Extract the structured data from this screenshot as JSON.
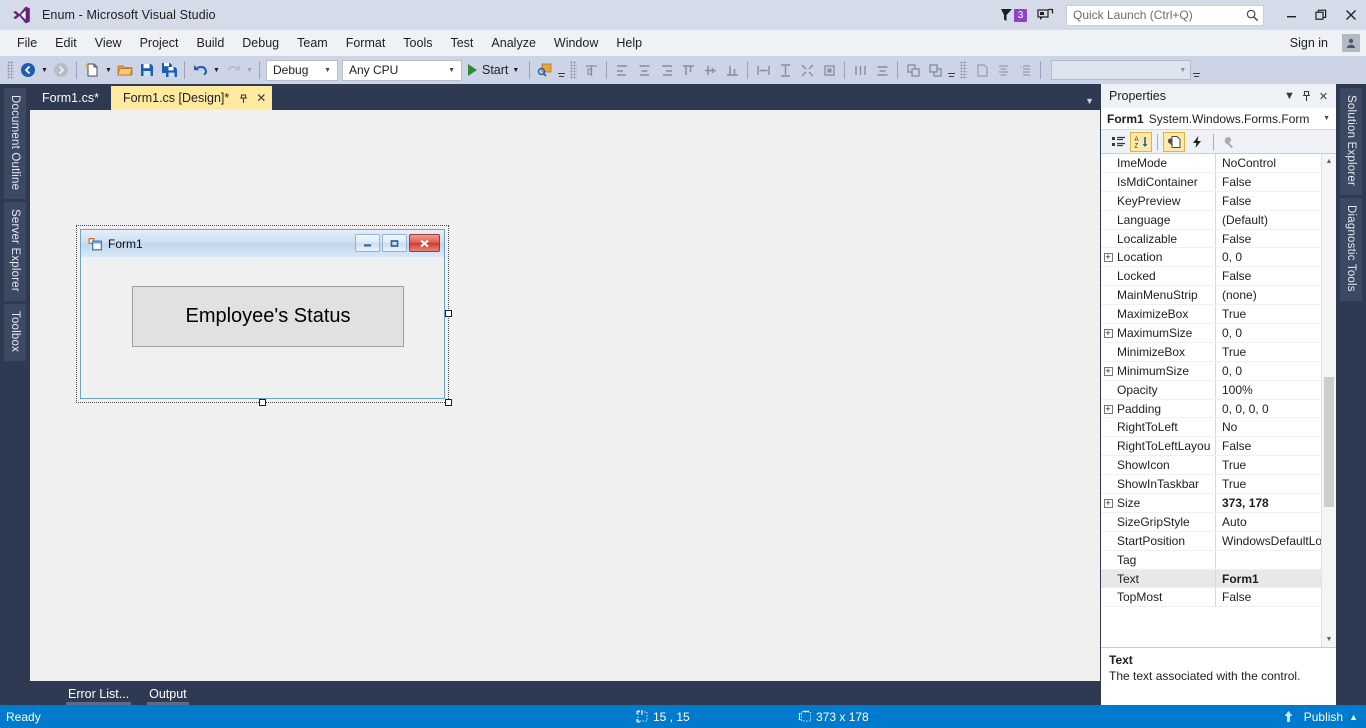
{
  "titlebar": {
    "app_title": "Enum - Microsoft Visual Studio",
    "logo_icon": "visual-studio-logo",
    "notification_icon": "notification-flag-icon",
    "notification_count": "3",
    "feedback_icon": "feedback-icon",
    "minimize_label": "–",
    "maximize_label": "❐",
    "close_label": "✕"
  },
  "quick_launch": {
    "placeholder": "Quick Launch (Ctrl+Q)",
    "value": "",
    "search_icon": "search-icon"
  },
  "menubar": {
    "items": [
      {
        "label": "File"
      },
      {
        "label": "Edit"
      },
      {
        "label": "View"
      },
      {
        "label": "Project"
      },
      {
        "label": "Build"
      },
      {
        "label": "Debug"
      },
      {
        "label": "Team"
      },
      {
        "label": "Format"
      },
      {
        "label": "Tools"
      },
      {
        "label": "Test"
      },
      {
        "label": "Analyze"
      },
      {
        "label": "Window"
      },
      {
        "label": "Help"
      }
    ],
    "signin_label": "Sign in",
    "account_icon": "account-icon"
  },
  "toolbar": {
    "navigate_back_icon": "navigate-back-icon",
    "navigate_forward_icon": "navigate-forward-icon",
    "new_item_icon": "new-item-icon",
    "open_file_icon": "open-file-icon",
    "save_icon": "save-icon",
    "save_all_icon": "save-all-icon",
    "undo_icon": "undo-icon",
    "redo_icon": "redo-icon",
    "config_combo": {
      "value": "Debug"
    },
    "platform_combo": {
      "value": "Any CPU"
    },
    "start_label": "Start",
    "start_icon": "play-icon",
    "find_icon": "find-in-files-icon",
    "layout_icons": [
      "align-to-grid-icon",
      "align-lefts-icon",
      "align-centers-icon",
      "align-rights-icon",
      "align-tops-icon",
      "align-middles-icon",
      "align-bottoms-icon",
      "make-same-width-icon",
      "make-same-height-icon",
      "make-same-size-icon",
      "size-to-grid-icon",
      "horizontal-spacing-icon",
      "vertical-spacing-icon",
      "bring-to-front-icon",
      "send-to-back-icon",
      "tab-order-icon",
      "center-horizontally-icon",
      "center-vertically-icon"
    ]
  },
  "left_dock": {
    "tabs": [
      {
        "label": "Document Outline"
      },
      {
        "label": "Server Explorer"
      },
      {
        "label": "Toolbox"
      }
    ]
  },
  "right_dock": {
    "tabs": [
      {
        "label": "Solution Explorer"
      },
      {
        "label": "Diagnostic Tools"
      }
    ]
  },
  "document_tabs": {
    "tabs": [
      {
        "label": "Form1.cs*",
        "active": false
      },
      {
        "label": "Form1.cs [Design]*",
        "active": true
      }
    ],
    "pin_icon": "pin-icon",
    "close_icon": "close-icon",
    "overflow_icon": "chevron-down-icon"
  },
  "designer": {
    "form": {
      "title": "Form1",
      "icon": "form-designer-icon",
      "minimize_label": "–",
      "maximize_label": "▭",
      "close_label": "✕",
      "controls": [
        {
          "type": "label",
          "text": "Employee's Status"
        }
      ]
    },
    "selection_handles": [
      "east",
      "south",
      "south-east"
    ]
  },
  "bottom_tabs": {
    "tabs": [
      {
        "label": "Error List..."
      },
      {
        "label": "Output"
      }
    ]
  },
  "properties": {
    "panel_title": "Properties",
    "dropdown_icon": "chevron-down-icon",
    "pin_icon": "pin-icon",
    "close_icon": "close-icon",
    "object_name": "Form1",
    "object_type": "System.Windows.Forms.Form",
    "object_dropdown_icon": "chevron-down-icon",
    "toolbar_buttons": [
      {
        "name": "categorized-icon",
        "active": false
      },
      {
        "name": "alphabetical-sort-icon",
        "active": true
      },
      {
        "name": "properties-page-icon",
        "active": true
      },
      {
        "name": "events-lightning-icon",
        "active": false
      },
      {
        "name": "property-pages-wrench-icon",
        "active": false
      }
    ],
    "rows": [
      {
        "name": "ImeMode",
        "value": "NoControl",
        "expandable": false,
        "bold": false,
        "selected": false
      },
      {
        "name": "IsMdiContainer",
        "value": "False",
        "expandable": false,
        "bold": false,
        "selected": false
      },
      {
        "name": "KeyPreview",
        "value": "False",
        "expandable": false,
        "bold": false,
        "selected": false
      },
      {
        "name": "Language",
        "value": "(Default)",
        "expandable": false,
        "bold": false,
        "selected": false
      },
      {
        "name": "Localizable",
        "value": "False",
        "expandable": false,
        "bold": false,
        "selected": false
      },
      {
        "name": "Location",
        "value": "0, 0",
        "expandable": true,
        "bold": false,
        "selected": false
      },
      {
        "name": "Locked",
        "value": "False",
        "expandable": false,
        "bold": false,
        "selected": false
      },
      {
        "name": "MainMenuStrip",
        "value": "(none)",
        "expandable": false,
        "bold": false,
        "selected": false
      },
      {
        "name": "MaximizeBox",
        "value": "True",
        "expandable": false,
        "bold": false,
        "selected": false
      },
      {
        "name": "MaximumSize",
        "value": "0, 0",
        "expandable": true,
        "bold": false,
        "selected": false
      },
      {
        "name": "MinimizeBox",
        "value": "True",
        "expandable": false,
        "bold": false,
        "selected": false
      },
      {
        "name": "MinimumSize",
        "value": "0, 0",
        "expandable": true,
        "bold": false,
        "selected": false
      },
      {
        "name": "Opacity",
        "value": "100%",
        "expandable": false,
        "bold": false,
        "selected": false
      },
      {
        "name": "Padding",
        "value": "0, 0, 0, 0",
        "expandable": true,
        "bold": false,
        "selected": false
      },
      {
        "name": "RightToLeft",
        "value": "No",
        "expandable": false,
        "bold": false,
        "selected": false
      },
      {
        "name": "RightToLeftLayou",
        "value": "False",
        "expandable": false,
        "bold": false,
        "selected": false
      },
      {
        "name": "ShowIcon",
        "value": "True",
        "expandable": false,
        "bold": false,
        "selected": false
      },
      {
        "name": "ShowInTaskbar",
        "value": "True",
        "expandable": false,
        "bold": false,
        "selected": false
      },
      {
        "name": "Size",
        "value": "373, 178",
        "expandable": true,
        "bold": true,
        "selected": false
      },
      {
        "name": "SizeGripStyle",
        "value": "Auto",
        "expandable": false,
        "bold": false,
        "selected": false
      },
      {
        "name": "StartPosition",
        "value": "WindowsDefaultLo",
        "expandable": false,
        "bold": false,
        "selected": false
      },
      {
        "name": "Tag",
        "value": "",
        "expandable": false,
        "bold": false,
        "selected": false
      },
      {
        "name": "Text",
        "value": "Form1",
        "expandable": false,
        "bold": true,
        "selected": true
      },
      {
        "name": "TopMost",
        "value": "False",
        "expandable": false,
        "bold": false,
        "selected": false
      }
    ],
    "description": {
      "title": "Text",
      "text": "The text associated with the control."
    },
    "scroll_up_icon": "scroll-up-icon",
    "scroll_down_icon": "scroll-down-icon"
  },
  "statusbar": {
    "status": "Ready",
    "position_icon": "cursor-position-icon",
    "position": "15 , 15",
    "size_icon": "selection-size-icon",
    "size": "373 x 178",
    "publish_icon": "publish-arrow-icon",
    "publish_label": "Publish",
    "publish_expand_icon": "chevron-up-icon"
  },
  "colors": {
    "accent": "#007acc",
    "titlebar_bg": "#d6dbe9",
    "toolbar_bg": "#ccd4e6",
    "dock_bg": "#2d3a52",
    "active_tab": "#ffeaa0",
    "badge": "#8e44c7"
  }
}
